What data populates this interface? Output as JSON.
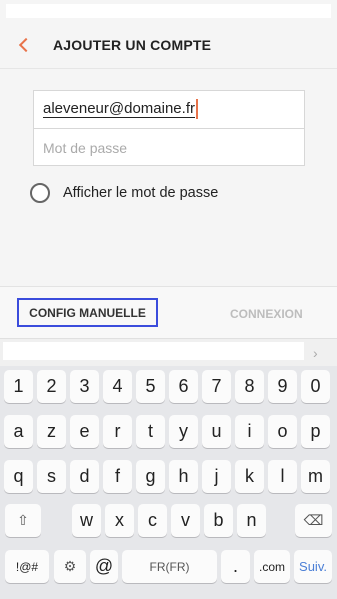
{
  "header": {
    "back_icon": "chevron-left-icon",
    "title": "AJOUTER UN COMPTE"
  },
  "form": {
    "email_value": "aleveneur@domaine.fr",
    "password_placeholder": "Mot de passe",
    "show_password_label": "Afficher le mot de passe",
    "show_password_checked": false
  },
  "actions": {
    "manual_config": "CONFIG MANUELLE",
    "connect": "CONNEXION"
  },
  "keyboard": {
    "suggestion_arrow_icon": "chevron-right-icon",
    "row_numbers": [
      "1",
      "2",
      "3",
      "4",
      "5",
      "6",
      "7",
      "8",
      "9",
      "0"
    ],
    "row1": [
      "a",
      "z",
      "e",
      "r",
      "t",
      "y",
      "u",
      "i",
      "o",
      "p"
    ],
    "row2": [
      "q",
      "s",
      "d",
      "f",
      "g",
      "h",
      "j",
      "k",
      "l",
      "m"
    ],
    "row3": [
      "w",
      "x",
      "c",
      "v",
      "b",
      "n"
    ],
    "shift_icon": "shift-icon",
    "backspace_icon": "backspace-icon",
    "symbols_label": "!@#",
    "settings_icon": "gear-icon",
    "at_label": "@",
    "space_label": "FR(FR)",
    "period_label": ".",
    "dotcom_label": ".com",
    "next_label": "Suiv."
  },
  "colors": {
    "accent_orange": "#e8734a",
    "focus_blue": "#3b4cdc",
    "next_blue": "#4b7fd6"
  }
}
